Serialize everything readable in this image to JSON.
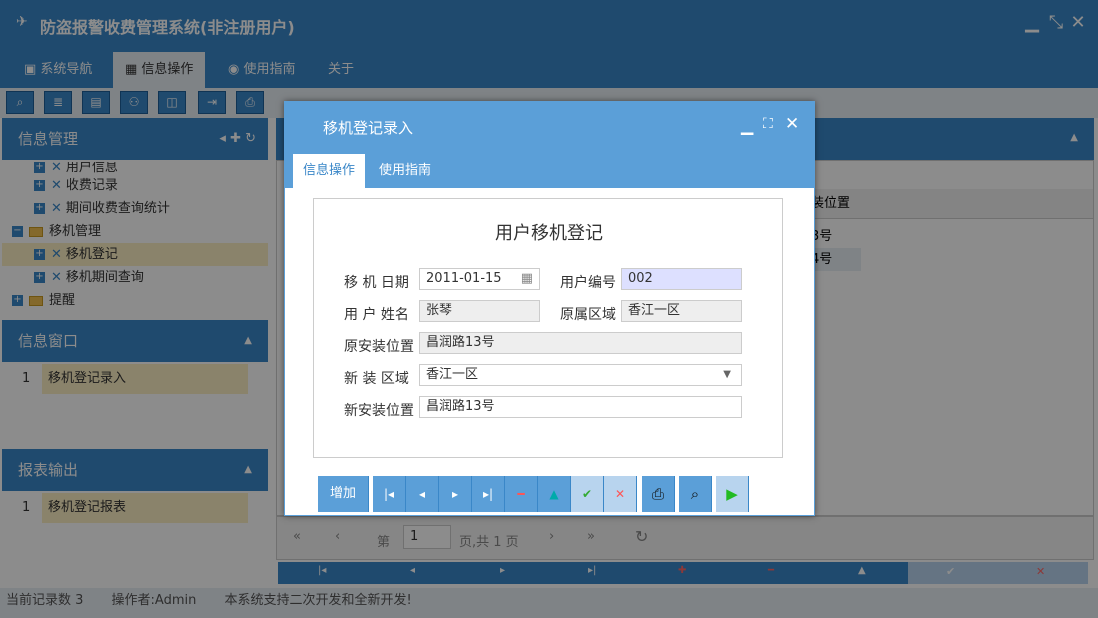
{
  "app": {
    "title": "防盗报警收费管理系统(非注册用户)"
  },
  "menu": [
    {
      "label": "系统导航"
    },
    {
      "label": "信息操作"
    },
    {
      "label": "使用指南"
    },
    {
      "label": "关于"
    }
  ],
  "left": {
    "info_mgmt": {
      "title": "信息管理",
      "items": [
        {
          "label": "用户信息"
        },
        {
          "label": "收费记录"
        },
        {
          "label": "期间收费查询统计"
        },
        {
          "label": "移机管理"
        },
        {
          "label": "移机登记"
        },
        {
          "label": "移机期间查询"
        },
        {
          "label": "提醒"
        }
      ]
    },
    "info_window": {
      "title": "信息窗口",
      "rows": [
        {
          "num": "1",
          "text": "移机登记录入"
        }
      ]
    },
    "report": {
      "title": "报表输出",
      "rows": [
        {
          "num": "1",
          "text": "移机登记报表"
        }
      ]
    }
  },
  "grid": {
    "col_fragment": "装位置",
    "cells": [
      "3号",
      "4号"
    ]
  },
  "pager": {
    "page_label": "第",
    "page_value": "1",
    "total_label": "页,共 1 页"
  },
  "status": {
    "records": "当前记录数 3",
    "operator": "操作者:Admin",
    "note": "本系统支持二次开发和全新开发!"
  },
  "dialog": {
    "title": "移机登记录入",
    "tabs": [
      {
        "label": "信息操作"
      },
      {
        "label": "使用指南"
      }
    ],
    "form_title": "用户移机登记",
    "labels": {
      "move_date": "移 机 日期",
      "user_no": "用户编号",
      "user_name": "用 户 姓名",
      "orig_area": "原属区域",
      "orig_loc": "原安装位置",
      "new_area": "新 装 区域",
      "new_loc": "新安装位置"
    },
    "values": {
      "move_date": "2011-01-15",
      "user_no": "002",
      "user_name": "张琴",
      "orig_area": "香江一区",
      "orig_loc": "昌润路13号",
      "new_area": "香江一区",
      "new_loc": "昌润路13号"
    },
    "buttons": {
      "add": "增加"
    }
  }
}
